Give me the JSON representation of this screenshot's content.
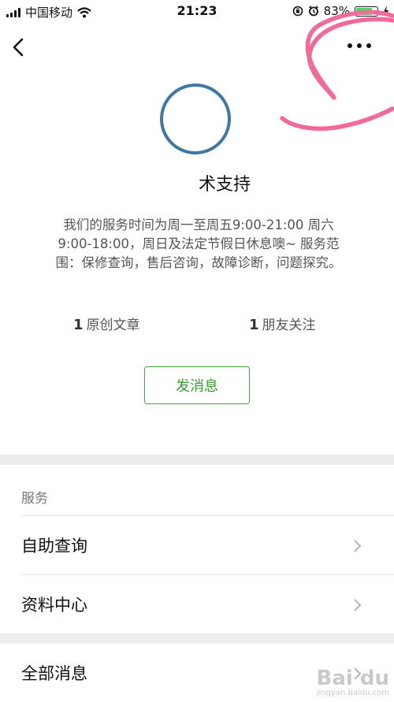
{
  "status_bar": {
    "carrier": "中国移动",
    "time": "21:23",
    "battery_percent": "83%",
    "battery_level": 0.83,
    "icons": [
      "signal-icon",
      "wifi-icon",
      "lock-rotation-icon",
      "alarm-icon",
      "battery-icon",
      "charging-icon"
    ]
  },
  "profile": {
    "name": "术支持",
    "description": "我们的服务时间为周一至周五9:00-21:00 周六9:00-18:00，周日及法定节假日休息噢~ 服务范围：保修查询，售后咨询，故障诊断，问题探究。",
    "stats": [
      {
        "count": "1",
        "label": "原创文章"
      },
      {
        "count": "1",
        "label": "朋友关注"
      }
    ],
    "send_button": "发消息"
  },
  "services": {
    "header": "服务",
    "items": [
      {
        "label": "自助查询"
      },
      {
        "label": "资料中心"
      }
    ]
  },
  "all_messages": {
    "label": "全部消息"
  },
  "watermark": {
    "text": "Bai du",
    "url": "jingyan.baidu.com"
  },
  "colors": {
    "accent_green": "#45a840",
    "avatar_ring": "#3f78a6",
    "annotation_pink": "#f06a9a",
    "battery_green": "#4cd964"
  }
}
